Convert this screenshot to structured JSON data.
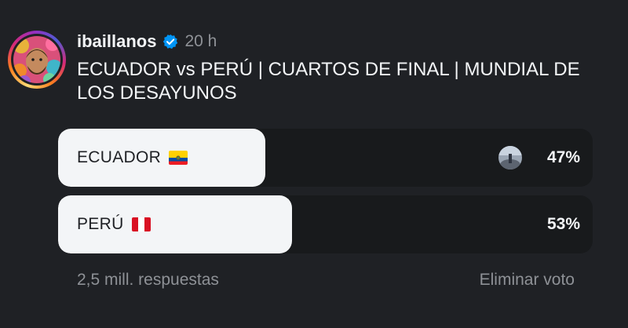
{
  "post": {
    "username": "ibaillanos",
    "verified_icon": "verified-badge-icon",
    "time": "20 h",
    "title": "ECUADOR vs PERÚ | CUARTOS DE FINAL | MUNDIAL DE LOS DESAYUNOS",
    "avatar_icon": "profile-avatar"
  },
  "poll": {
    "options": [
      {
        "label": "ECUADOR",
        "flag_icon": "ecuador-flag-icon",
        "percent": "47%",
        "fill_fraction": 0.47,
        "voted": true
      },
      {
        "label": "PERÚ",
        "flag_icon": "peru-flag-icon",
        "percent": "53%",
        "fill_fraction": 0.53,
        "voted": false
      }
    ],
    "responses": "2,5 mill. respuestas",
    "remove_vote": "Eliminar voto"
  },
  "colors": {
    "background": "#1f2125",
    "option_track": "#181a1c",
    "option_fill": "#f3f5f7",
    "verified": "#0095f6",
    "secondary_text": "#8e9196"
  }
}
